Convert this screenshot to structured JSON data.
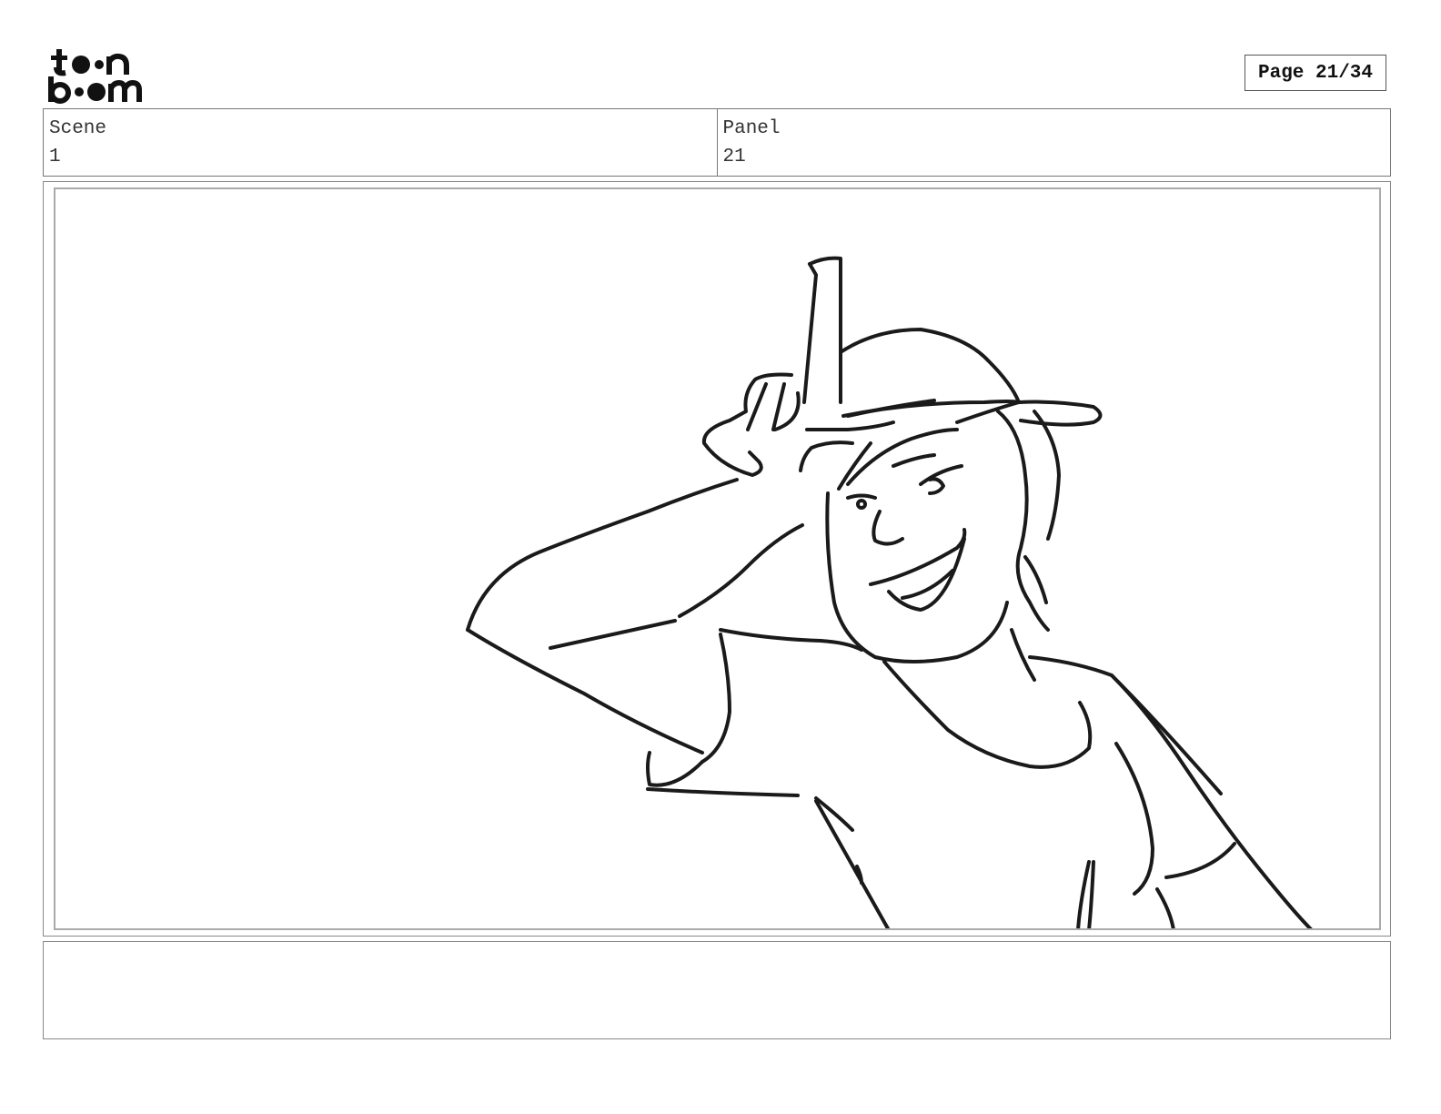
{
  "brand": {
    "logo_text": "toon boom"
  },
  "page": {
    "label": "Page 21/34"
  },
  "scene": {
    "label": "Scene",
    "value": "1"
  },
  "panel": {
    "label": "Panel",
    "value": "21"
  },
  "artwork": {
    "description_icon": "sketch-boy-with-cap-loser-sign"
  },
  "notes": {
    "text": ""
  }
}
